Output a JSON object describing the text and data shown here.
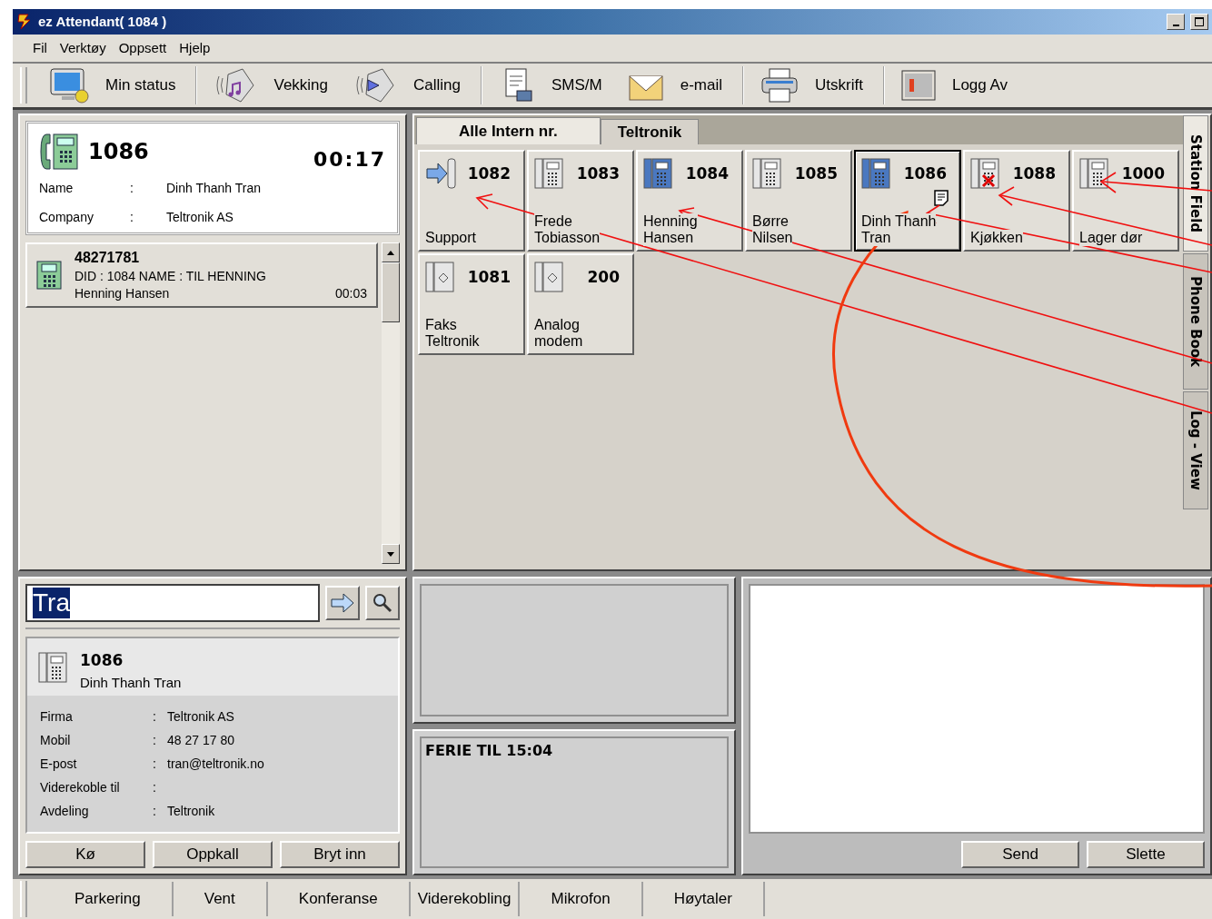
{
  "window": {
    "title": "ez Attendant( 1084 )"
  },
  "menu": [
    "Fil",
    "Verktøy",
    "Oppsett",
    "Hjelp"
  ],
  "toolbar": [
    {
      "label": "Min status",
      "separator_after": true
    },
    {
      "label": "Vekking",
      "separator_after": false
    },
    {
      "label": "Calling",
      "separator_after": true
    },
    {
      "label": "SMS/M",
      "separator_after": false
    },
    {
      "label": "e-mail",
      "separator_after": true
    },
    {
      "label": "Utskrift",
      "separator_after": true
    },
    {
      "label": "Logg Av",
      "separator_after": false
    }
  ],
  "active_call": {
    "number": "1086",
    "timer": "00:17",
    "fields": [
      {
        "label": "Name",
        "colon": ":",
        "value": "Dinh Thanh Tran"
      },
      {
        "label": "Company",
        "colon": ":",
        "value": "Teltronik AS"
      }
    ]
  },
  "queue": [
    {
      "number": "48271781",
      "info": "DID : 1084  NAME : TIL HENNING",
      "name": "Henning Hansen",
      "time": "00:03"
    }
  ],
  "tabs": [
    {
      "label": "Alle Intern nr.",
      "selected": true
    },
    {
      "label": "Teltronik",
      "selected": false
    }
  ],
  "stations": [
    {
      "kind": "forward",
      "in_use": false,
      "blocked": false,
      "number": "1082",
      "name": "Support",
      "selected": false,
      "note": false
    },
    {
      "kind": "phone",
      "in_use": false,
      "blocked": false,
      "number": "1083",
      "name": "Frede\nTobiasson",
      "selected": false,
      "note": false
    },
    {
      "kind": "phone",
      "in_use": true,
      "blocked": false,
      "number": "1084",
      "name": "Henning\nHansen",
      "selected": false,
      "note": false
    },
    {
      "kind": "phone",
      "in_use": false,
      "blocked": false,
      "number": "1085",
      "name": "Børre\nNilsen",
      "selected": false,
      "note": false
    },
    {
      "kind": "phone",
      "in_use": true,
      "blocked": false,
      "number": "1086",
      "name": "Dinh Thanh\nTran",
      "selected": true,
      "note": true
    },
    {
      "kind": "phone",
      "in_use": false,
      "blocked": true,
      "number": "1088",
      "name": "Kjøkken",
      "selected": false,
      "note": false
    },
    {
      "kind": "phone",
      "in_use": false,
      "blocked": false,
      "number": "1000",
      "name": "Lager dør",
      "selected": false,
      "note": false
    },
    {
      "kind": "fax",
      "in_use": false,
      "blocked": false,
      "number": "1081",
      "name": "Faks\nTeltronik",
      "selected": false,
      "note": false
    },
    {
      "kind": "fax",
      "in_use": false,
      "blocked": false,
      "number": "200",
      "name": "Analog\nmodem",
      "selected": false,
      "note": false
    }
  ],
  "side_tabs": [
    {
      "label": "Station Field",
      "selected": true
    },
    {
      "label": "Phone Book",
      "selected": false
    },
    {
      "label": "Log - View",
      "selected": false
    }
  ],
  "search": {
    "value": "Tra"
  },
  "contact": {
    "number": "1086",
    "name": "Dinh Thanh Tran",
    "fields": [
      {
        "label": "Firma",
        "colon": ":",
        "value": "Teltronik AS"
      },
      {
        "label": "Mobil",
        "colon": ":",
        "value": "48 27 17 80"
      },
      {
        "label": "E-post",
        "colon": ":",
        "value": "tran@teltronik.no"
      },
      {
        "label": "Viderekoble til",
        "colon": ":"
      },
      {
        "label": "Avdeling",
        "colon": ":",
        "value": "Teltronik"
      }
    ]
  },
  "contact_buttons": [
    "Kø",
    "Oppkall",
    "Bryt inn"
  ],
  "notes": [
    {
      "text": "FERIE TIL 15:04"
    }
  ],
  "message_buttons": [
    "Send",
    "Slette"
  ],
  "bottom_bar": [
    "Parkering",
    "Vent",
    "Konferanse",
    "Viderekobling",
    "Mikrofon",
    "Høytaler"
  ]
}
